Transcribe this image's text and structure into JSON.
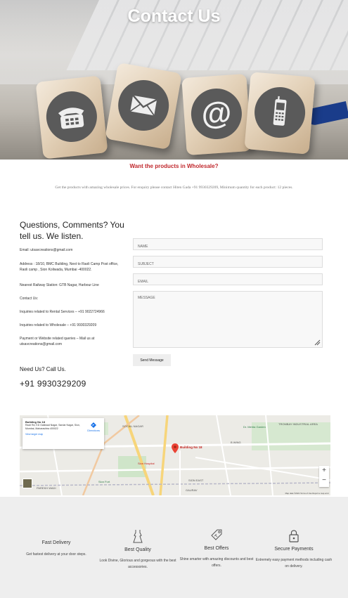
{
  "hero": {
    "title": "Contact Us"
  },
  "wholesale": {
    "title": "Want the products in Wholesale?",
    "text": "Get the products with amazing wholesale prices. For enquiry please contact Hiten Gada +91 9930329209, Minimum quantity for each product: 12 pieces."
  },
  "contact": {
    "heading": "Questions, Comments? You tell us. We listen.",
    "email": "Email: utsavcreations@gmail.com",
    "address": "Address : 18/10, BMC Building, Next to Raoli Camp Post office, Raoli camp , Sion Koliwada, Mumbai -400022.",
    "railway": "Nearest Railway Station: GTB Nagar, Harbour Line",
    "contact_us": "Contact Us:",
    "rental": "Inquiries related to Rental Services – +91 9022724966",
    "wholesale": "Inquiries related to Wholesale – +91 9930329209",
    "payment": "Payment or Website related queries – Mail us at utsavcreations@gmail.com",
    "need_call": "Need Us? Call Us.",
    "phone": "+91 9930329209"
  },
  "form": {
    "name_placeholder": "NAME",
    "subject_placeholder": "SUBJECT",
    "email_placeholder": "EMAIL",
    "message_placeholder": "MESSAGE",
    "send_label": "Send Message"
  },
  "map": {
    "place_name": "Building No 18",
    "place_address": "Raoli Rd, KD Gaikwad Nagar, Sardar Nagar, Sion, Mumbai, Maharashtra 400022",
    "directions": "Directions",
    "view_larger": "View larger map",
    "pin_label": "Building No 18",
    "zoom_in": "+",
    "zoom_out": "−",
    "footer": "Map data ©2021   Terms of Use   Report a map error",
    "labels": {
      "social_nagar": "SOCIAL NAGAR",
      "trombay": "TROMBAY INDUSTRIAL AREA",
      "sion_east": "SION EAST",
      "gaurav": "GAURAV",
      "parekh": "PAREKH WADI",
      "sion_hospital": "Sion Hospital",
      "sion_fort": "Sion Fort",
      "b_wing": "B WING",
      "dr_mehta": "Dr. Mehta Garden"
    }
  },
  "features": [
    {
      "title": "Fast Delivery",
      "desc": "Get fastest delivery at your door steps.",
      "icon": "delivery-icon"
    },
    {
      "title": "Best Quality",
      "desc": "Look Divine, Glorious and gorgeous with the best accessories.",
      "icon": "dress-icon"
    },
    {
      "title": "Best Offers",
      "desc": "Shine smarter with amazing discounts and best offers.",
      "icon": "tag-icon"
    },
    {
      "title": "Secure Payments",
      "desc": "Extremely easy payment methods including cash on delivery.",
      "icon": "lock-icon"
    }
  ]
}
